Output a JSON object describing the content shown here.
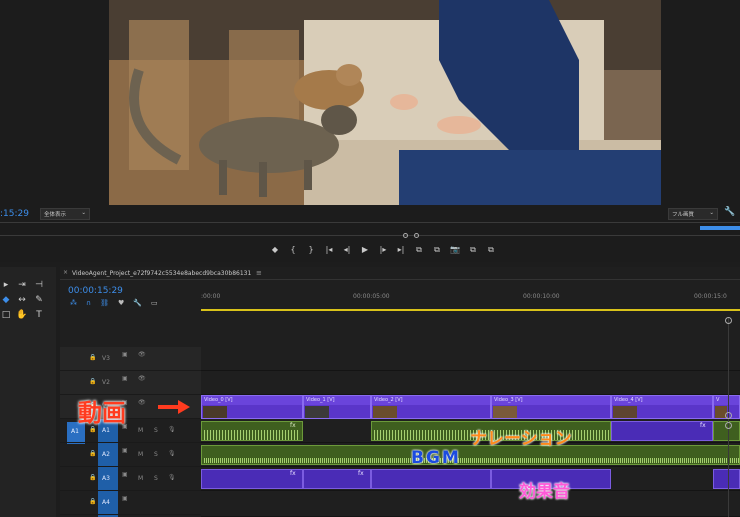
{
  "monitor": {
    "timecode_left": ":15:29",
    "fit_dropdown": "全体表示",
    "quality_dropdown": "フル画質",
    "controls": [
      "◆",
      "{",
      "}",
      "|◂",
      "◂|",
      "▶",
      "|▸",
      "▸|",
      "⧉",
      "⧉",
      "📷",
      "⧉",
      "⧉"
    ]
  },
  "timeline": {
    "tab_close": "×",
    "sequence_name": "VideoAgent_Project_e72f9742c5534e8abecd9bca30b86131",
    "menu_glyph": "≡",
    "timecode": "00:00:15:29",
    "ruler": [
      ":00:00",
      "00:00:05:00",
      "00:00:10:00",
      "00:00:15:0"
    ],
    "tracks": [
      {
        "name": "V3"
      },
      {
        "name": "V2"
      },
      {
        "name": "V1"
      },
      {
        "name": "A1",
        "src": "A1"
      },
      {
        "name": "A2"
      },
      {
        "name": "A3"
      },
      {
        "name": "A4"
      }
    ],
    "track_letters": {
      "mute": "M",
      "solo": "S"
    },
    "video_clips": [
      "Video_0 [V]",
      "Video_1 [V]",
      "Video_2 [V]",
      "Video_3 [V]",
      "Video_4 [V]",
      "V"
    ],
    "fx": "fx"
  },
  "annotations": {
    "video": "動画",
    "narration": "ナレーション",
    "bgm": "BGM",
    "sfx": "効果音"
  },
  "colors": {
    "accent_blue": "#3d8eea",
    "video_clip": "#5a35c9",
    "audio_green": "#3f5f1f",
    "annotation_red": "#ff3b1f",
    "annotation_orange": "#ff8a1a",
    "annotation_blue": "#1b4be0",
    "annotation_pink": "#ff5ad8"
  }
}
